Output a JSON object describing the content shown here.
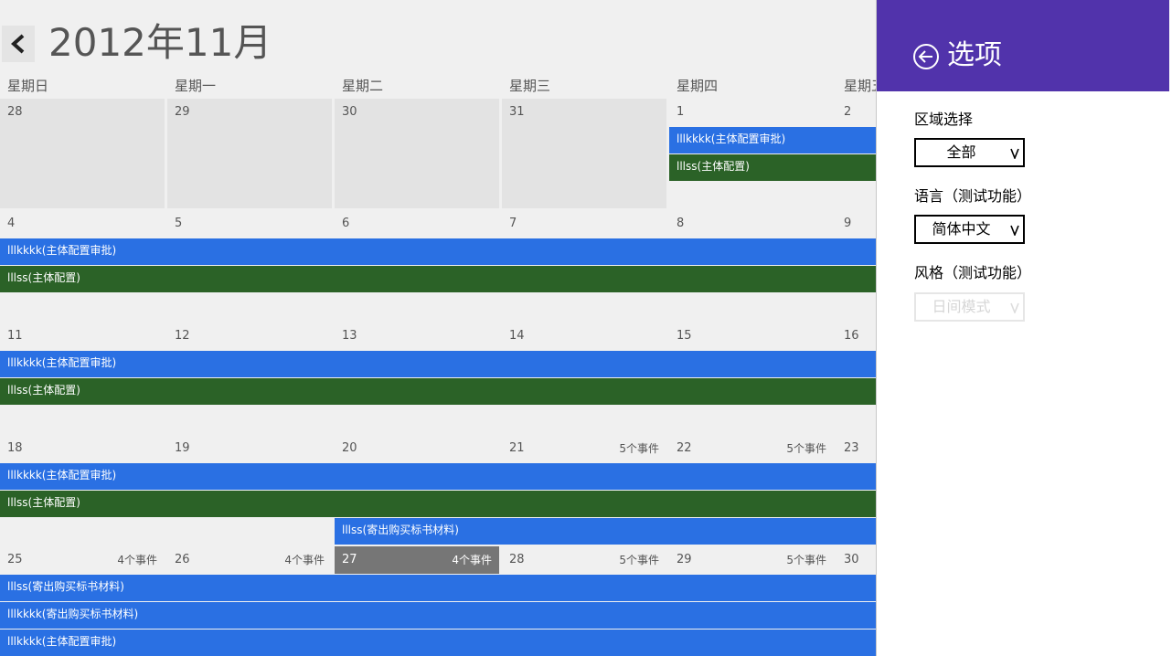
{
  "calendar": {
    "title": "2012年11月",
    "weekdays": [
      "星期日",
      "星期一",
      "星期二",
      "星期三",
      "星期四",
      "星期五"
    ],
    "weeks": [
      {
        "days": [
          {
            "date": "28",
            "other": true,
            "count": ""
          },
          {
            "date": "29",
            "other": true,
            "count": ""
          },
          {
            "date": "30",
            "other": true,
            "count": ""
          },
          {
            "date": "31",
            "other": true,
            "count": ""
          },
          {
            "date": "1",
            "other": false,
            "count": ""
          },
          {
            "date": "2",
            "other": false,
            "count": ""
          }
        ],
        "events": [
          {
            "label": "lllkkkk(主体配置审批)",
            "color": "blue",
            "startCol": 4,
            "lane": 0
          },
          {
            "label": "lllss(主体配置)",
            "color": "green",
            "startCol": 4,
            "lane": 1
          }
        ]
      },
      {
        "days": [
          {
            "date": "4",
            "count": ""
          },
          {
            "date": "5",
            "count": ""
          },
          {
            "date": "6",
            "count": ""
          },
          {
            "date": "7",
            "count": ""
          },
          {
            "date": "8",
            "count": ""
          },
          {
            "date": "9",
            "count": ""
          }
        ],
        "events": [
          {
            "label": "lllkkkk(主体配置审批)",
            "color": "blue",
            "startCol": 0,
            "lane": 0
          },
          {
            "label": "lllss(主体配置)",
            "color": "green",
            "startCol": 0,
            "lane": 1
          }
        ]
      },
      {
        "days": [
          {
            "date": "11",
            "count": ""
          },
          {
            "date": "12",
            "count": ""
          },
          {
            "date": "13",
            "count": ""
          },
          {
            "date": "14",
            "count": ""
          },
          {
            "date": "15",
            "count": ""
          },
          {
            "date": "16",
            "count": ""
          }
        ],
        "events": [
          {
            "label": "lllkkkk(主体配置审批)",
            "color": "blue",
            "startCol": 0,
            "lane": 0
          },
          {
            "label": "lllss(主体配置)",
            "color": "green",
            "startCol": 0,
            "lane": 1
          }
        ]
      },
      {
        "days": [
          {
            "date": "18",
            "count": ""
          },
          {
            "date": "19",
            "count": ""
          },
          {
            "date": "20",
            "count": ""
          },
          {
            "date": "21",
            "count": "5个事件"
          },
          {
            "date": "22",
            "count": "5个事件"
          },
          {
            "date": "23",
            "count": ""
          }
        ],
        "events": [
          {
            "label": "lllkkkk(主体配置审批)",
            "color": "blue",
            "startCol": 0,
            "lane": 0
          },
          {
            "label": "lllss(主体配置)",
            "color": "green",
            "startCol": 0,
            "lane": 1
          },
          {
            "label": "lllss(寄出购买标书材料)",
            "color": "blue",
            "startCol": 2,
            "lane": 2
          }
        ]
      },
      {
        "days": [
          {
            "date": "25",
            "count": "4个事件"
          },
          {
            "date": "26",
            "count": "4个事件"
          },
          {
            "date": "27",
            "count": "4个事件",
            "today": true
          },
          {
            "date": "28",
            "count": "5个事件"
          },
          {
            "date": "29",
            "count": "5个事件"
          },
          {
            "date": "30",
            "count": ""
          }
        ],
        "events": [
          {
            "label": "lllss(寄出购买标书材料)",
            "color": "blue",
            "startCol": 0,
            "lane": 0
          },
          {
            "label": "lllkkkk(寄出购买标书材料)",
            "color": "blue",
            "startCol": 0,
            "lane": 1
          },
          {
            "label": "lllkkkk(主体配置审批)",
            "color": "blue",
            "startCol": 0,
            "lane": 2
          }
        ]
      }
    ]
  },
  "options": {
    "title": "选项",
    "region_label": "区域选择",
    "region_value": "全部",
    "language_label": "语言（测试功能）",
    "language_value": "简体中文",
    "style_label": "风格（测试功能）",
    "style_value": "日间模式",
    "accent_color": "#5133ab"
  },
  "icons": {
    "back": "chevron-left-icon",
    "panel_back": "circle-arrow-left-icon",
    "select_arrow": "chevron-down-icon"
  }
}
